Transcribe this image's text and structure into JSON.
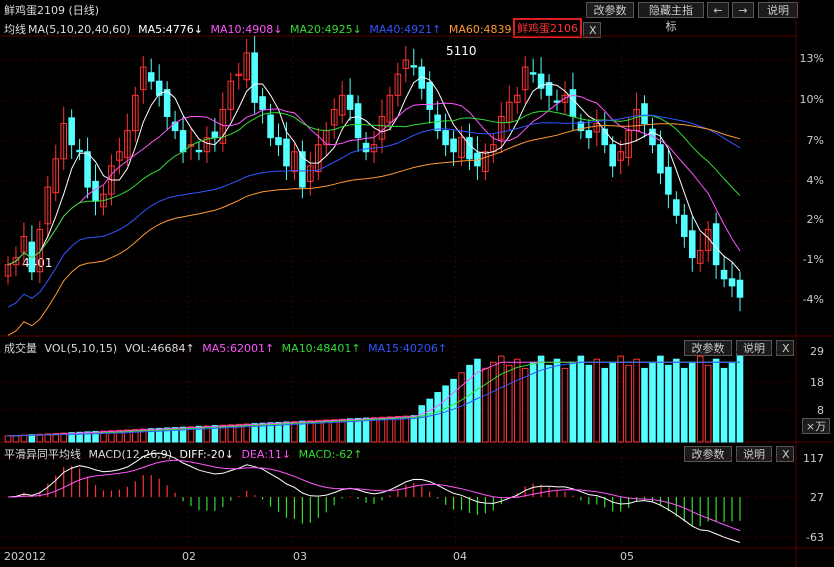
{
  "title": "鲜鸡蛋2109 (日线)",
  "toolbar": {
    "params": "改参数",
    "hide_main": "隐藏主指标",
    "prev": "←",
    "next": "→",
    "help": "说明"
  },
  "ma_header": {
    "label": "均线",
    "params": "MA(5,10,20,40,60)",
    "ma5": "MA5:4776↓",
    "ma10": "MA10:4908↓",
    "ma20": "MA20:4925↓",
    "ma40": "MA40:4921↑",
    "ma60": "MA60:4839↑"
  },
  "overlay": {
    "tag": "鲜鸡蛋2106",
    "close": "X"
  },
  "price_axis": [
    "13%",
    "10%",
    "7%",
    "4%",
    "2%",
    "-1%",
    "-4%"
  ],
  "annotations": {
    "high": "5110",
    "low": "4401"
  },
  "vol_header": {
    "label": "成交量",
    "params": "VOL(5,10,15)",
    "vol": "VOL:46684↑",
    "ma5": "MA5:62001↑",
    "ma10": "MA10:48401↑",
    "ma15": "MA15:40206↑"
  },
  "vol_buttons": {
    "params": "改参数",
    "help": "说明",
    "close": "X"
  },
  "vol_axis": [
    "29",
    "18",
    "8"
  ],
  "vol_unit": "×万",
  "macd_header": {
    "label": "平滑异同平均线",
    "params": "MACD(12,26,9)",
    "diff": "DIFF:-20↓",
    "dea": "DEA:11↓",
    "macd": "MACD:-62↑"
  },
  "macd_buttons": {
    "params": "改参数",
    "help": "说明",
    "close": "X"
  },
  "macd_axis": [
    "117",
    "27",
    "-63"
  ],
  "x_axis": [
    "202012",
    "02",
    "03",
    "04",
    "05"
  ],
  "colors": {
    "up": "#ff3333",
    "down": "#54ffff",
    "ma5": "#ffffff",
    "ma10": "#ff55ff",
    "ma20": "#33dd33",
    "ma40": "#3355ff",
    "ma60": "#ff9933",
    "grid": "#3a0000"
  },
  "chart_data": {
    "type": "candlestick",
    "title": "鲜鸡蛋2109 (日线)",
    "price_high": 5110,
    "price_low": 4401,
    "close_pct_series": [
      -1.5,
      -1.0,
      0.5,
      -2.0,
      1.0,
      4.0,
      6.0,
      8.5,
      7.0,
      6.5,
      4.0,
      3.0,
      3.5,
      5.5,
      6.5,
      8.0,
      10.5,
      12.5,
      11.5,
      10.5,
      9.0,
      8.0,
      6.5,
      7.0,
      6.5,
      7.5,
      7.5,
      9.5,
      11.5,
      12.0,
      13.5,
      10.0,
      9.5,
      7.5,
      7.0,
      5.5,
      6.5,
      4.0,
      5.5,
      7.0,
      8.0,
      9.5,
      10.5,
      9.5,
      7.5,
      6.5,
      7.0,
      9.0,
      10.5,
      12.0,
      13.0,
      12.5,
      11.0,
      9.5,
      8.0,
      7.0,
      6.5,
      7.5,
      6.0,
      5.5,
      6.5,
      7.0,
      9.0,
      10.0,
      10.5,
      12.5,
      12.0,
      11.0,
      10.5,
      10.0,
      10.5,
      9.0,
      8.0,
      7.5,
      8.5,
      7.0,
      5.5,
      6.5,
      8.0,
      9.5,
      8.5,
      7.0,
      5.0,
      3.5,
      2.0,
      0.5,
      -1.0,
      -0.5,
      1.0,
      -1.5,
      -2.5,
      -3.0,
      -3.8
    ],
    "volume_axis": [
      8,
      18,
      29
    ],
    "macd_axis": [
      -63,
      27,
      117
    ]
  }
}
